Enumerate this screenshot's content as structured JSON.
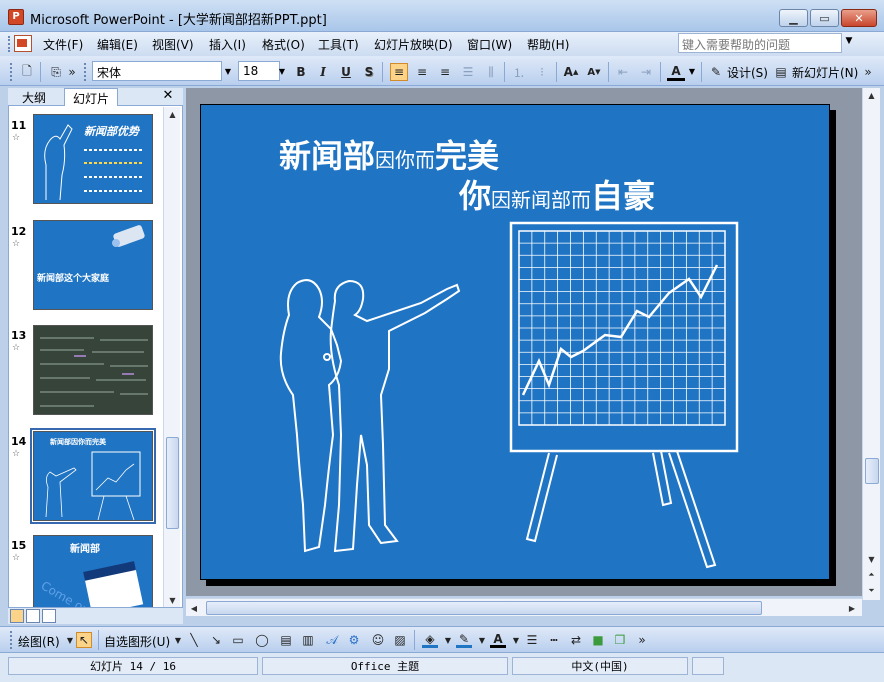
{
  "window": {
    "title": "Microsoft PowerPoint - [大学新闻部招新PPT.ppt]",
    "icon": "powerpoint-icon"
  },
  "menu": {
    "items": [
      "文件(F)",
      "编辑(E)",
      "视图(V)",
      "插入(I)",
      "格式(O)",
      "工具(T)",
      "幻灯片放映(D)",
      "窗口(W)",
      "帮助(H)"
    ],
    "help_placeholder": "键入需要帮助的问题"
  },
  "toolbar": {
    "font_name": "宋体",
    "font_size": "18",
    "bold": "B",
    "italic": "I",
    "underline": "U",
    "shadow": "S",
    "design_label": "设计(S)",
    "new_slide_label": "新幻灯片(N)"
  },
  "panel": {
    "tabs": [
      "大纲",
      "幻灯片"
    ],
    "slides": [
      {
        "num": "11",
        "text": "新闻部优势"
      },
      {
        "num": "12",
        "text": "新闻部这个大家庭"
      },
      {
        "num": "13",
        "text": ""
      },
      {
        "num": "14",
        "text": "新闻部因你而完美"
      },
      {
        "num": "15",
        "text": "新闻部"
      }
    ],
    "selected_slide": "14"
  },
  "slide": {
    "line1_big": "新闻部",
    "line1_small": "因你而",
    "line1_big2": "完美",
    "line2_big": "你",
    "line2_small": "因新闻部而",
    "line2_big2": "自豪",
    "background": "#1f74c4"
  },
  "drawbar": {
    "draw_label": "绘图(R)",
    "autoshape_label": "自选图形(U)"
  },
  "status": {
    "slide_pos": "幻灯片 14 / 16",
    "theme": "Office 主题",
    "language": "中文(中国)"
  }
}
